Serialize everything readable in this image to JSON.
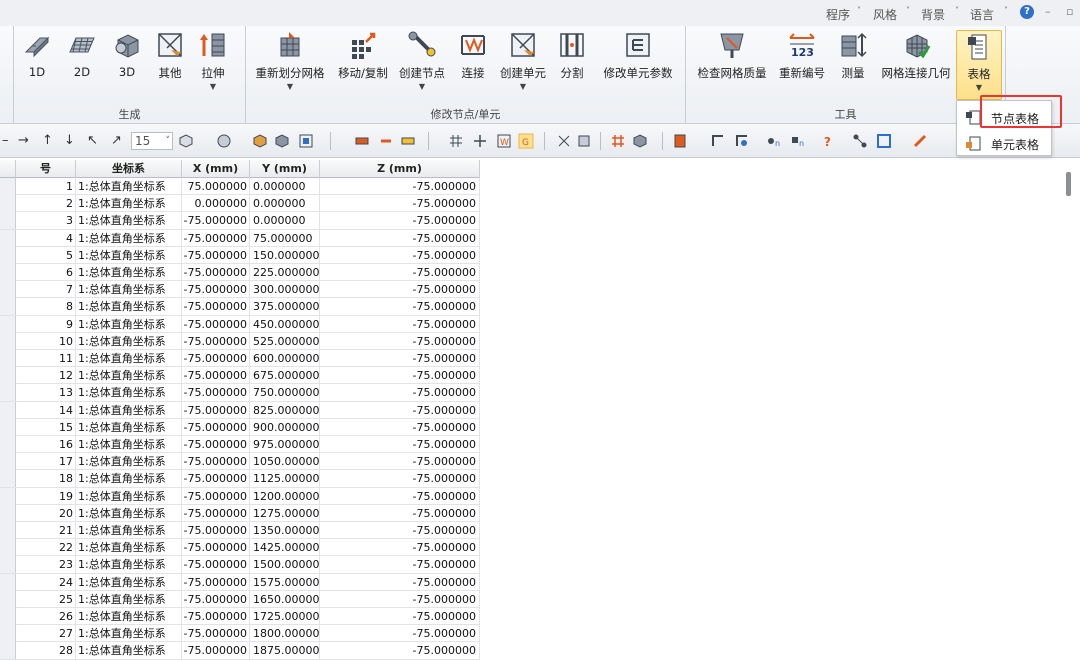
{
  "topmenu": {
    "items": [
      {
        "label": "程序"
      },
      {
        "label": "风格"
      },
      {
        "label": "背景"
      },
      {
        "label": "语言"
      }
    ],
    "help": "?"
  },
  "ribbon": {
    "groups": [
      {
        "label": "生成",
        "buttons": [
          {
            "label": "1D",
            "icon": "1d-mesh-icon"
          },
          {
            "label": "2D",
            "icon": "2d-mesh-icon"
          },
          {
            "label": "3D",
            "icon": "3d-mesh-icon"
          },
          {
            "label": "其他",
            "icon": "other-mesh-icon"
          },
          {
            "label": "拉伸",
            "icon": "extrude-icon"
          }
        ]
      },
      {
        "label": "修改节点/单元",
        "buttons": [
          {
            "label": "重新划分网格",
            "icon": "remesh-icon"
          },
          {
            "label": "移动/复制",
            "icon": "move-copy-icon"
          },
          {
            "label": "创建节点",
            "icon": "create-node-icon"
          },
          {
            "label": "连接",
            "icon": "connect-icon"
          },
          {
            "label": "创建单元",
            "icon": "create-element-icon"
          },
          {
            "label": "分割",
            "icon": "divide-icon"
          },
          {
            "label": "修改单元参数",
            "icon": "modify-element-icon"
          }
        ]
      },
      {
        "label": "工具",
        "buttons": [
          {
            "label": "检查网格质量",
            "icon": "check-quality-icon"
          },
          {
            "label": "重新编号",
            "icon": "renumber-icon"
          },
          {
            "label": "测量",
            "icon": "measure-icon"
          },
          {
            "label": "网格连接几何",
            "icon": "mesh-geometry-icon"
          },
          {
            "label": "表格",
            "icon": "table-icon"
          }
        ]
      }
    ]
  },
  "dropdown": {
    "items": [
      {
        "label": "节点表格"
      },
      {
        "label": "单元表格"
      }
    ]
  },
  "toolbar": {
    "combo_value": "15"
  },
  "colors": {
    "highlight": "#e33333",
    "ribbon_active": "#fde08a"
  },
  "table": {
    "columns": [
      "号",
      "坐标系",
      "X (mm)",
      "Y (mm)",
      "Z (mm)"
    ],
    "rows": [
      [
        "1",
        "1:总体直角坐标系",
        "75.000000",
        "0.000000",
        "-75.000000"
      ],
      [
        "2",
        "1:总体直角坐标系",
        "0.000000",
        "0.000000",
        "-75.000000"
      ],
      [
        "3",
        "1:总体直角坐标系",
        "-75.000000",
        "0.000000",
        "-75.000000"
      ],
      [
        "4",
        "1:总体直角坐标系",
        "-75.000000",
        "75.000000",
        "-75.000000"
      ],
      [
        "5",
        "1:总体直角坐标系",
        "-75.000000",
        "150.000000",
        "-75.000000"
      ],
      [
        "6",
        "1:总体直角坐标系",
        "-75.000000",
        "225.000000",
        "-75.000000"
      ],
      [
        "7",
        "1:总体直角坐标系",
        "-75.000000",
        "300.000000",
        "-75.000000"
      ],
      [
        "8",
        "1:总体直角坐标系",
        "-75.000000",
        "375.000000",
        "-75.000000"
      ],
      [
        "9",
        "1:总体直角坐标系",
        "-75.000000",
        "450.000000",
        "-75.000000"
      ],
      [
        "10",
        "1:总体直角坐标系",
        "-75.000000",
        "525.000000",
        "-75.000000"
      ],
      [
        "11",
        "1:总体直角坐标系",
        "-75.000000",
        "600.000000",
        "-75.000000"
      ],
      [
        "12",
        "1:总体直角坐标系",
        "-75.000000",
        "675.000000",
        "-75.000000"
      ],
      [
        "13",
        "1:总体直角坐标系",
        "-75.000000",
        "750.000000",
        "-75.000000"
      ],
      [
        "14",
        "1:总体直角坐标系",
        "-75.000000",
        "825.000000",
        "-75.000000"
      ],
      [
        "15",
        "1:总体直角坐标系",
        "-75.000000",
        "900.000000",
        "-75.000000"
      ],
      [
        "16",
        "1:总体直角坐标系",
        "-75.000000",
        "975.000000",
        "-75.000000"
      ],
      [
        "17",
        "1:总体直角坐标系",
        "-75.000000",
        "1050.000000",
        "-75.000000"
      ],
      [
        "18",
        "1:总体直角坐标系",
        "-75.000000",
        "1125.000000",
        "-75.000000"
      ],
      [
        "19",
        "1:总体直角坐标系",
        "-75.000000",
        "1200.000000",
        "-75.000000"
      ],
      [
        "20",
        "1:总体直角坐标系",
        "-75.000000",
        "1275.000000",
        "-75.000000"
      ],
      [
        "21",
        "1:总体直角坐标系",
        "-75.000000",
        "1350.000000",
        "-75.000000"
      ],
      [
        "22",
        "1:总体直角坐标系",
        "-75.000000",
        "1425.000000",
        "-75.000000"
      ],
      [
        "23",
        "1:总体直角坐标系",
        "-75.000000",
        "1500.000000",
        "-75.000000"
      ],
      [
        "24",
        "1:总体直角坐标系",
        "-75.000000",
        "1575.000000",
        "-75.000000"
      ],
      [
        "25",
        "1:总体直角坐标系",
        "-75.000000",
        "1650.000000",
        "-75.000000"
      ],
      [
        "26",
        "1:总体直角坐标系",
        "-75.000000",
        "1725.000000",
        "-75.000000"
      ],
      [
        "27",
        "1:总体直角坐标系",
        "-75.000000",
        "1800.000000",
        "-75.000000"
      ],
      [
        "28",
        "1:总体直角坐标系",
        "-75.000000",
        "1875.000000",
        "-75.000000"
      ]
    ]
  }
}
